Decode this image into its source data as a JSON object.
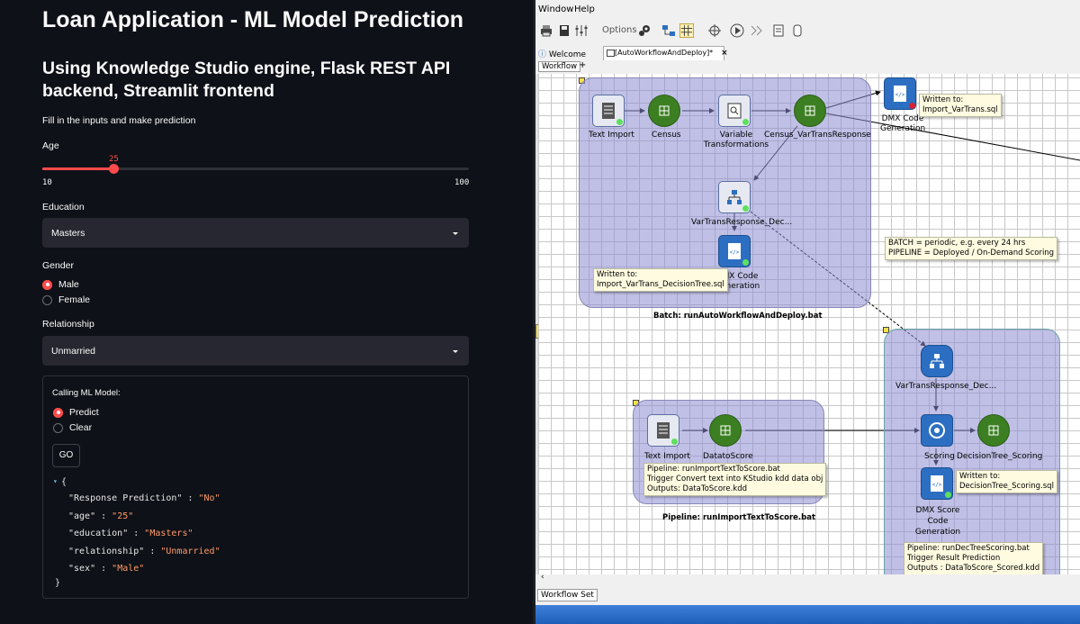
{
  "app": {
    "title": "Loan Application - ML Model Prediction",
    "subtitle": "Using Knowledge Studio engine, Flask REST API backend, Streamlit frontend",
    "instructions": "Fill in the inputs and make prediction"
  },
  "age": {
    "label": "Age",
    "value": "25",
    "value_num": 25,
    "min": "10",
    "max": "100",
    "min_num": 10,
    "max_num": 100
  },
  "education": {
    "label": "Education",
    "selected": "Masters"
  },
  "gender": {
    "label": "Gender",
    "options": [
      "Male",
      "Female"
    ],
    "selected": "Male"
  },
  "relationship": {
    "label": "Relationship",
    "selected": "Unmarried"
  },
  "form": {
    "title": "Calling ML Model:",
    "options": [
      "Predict",
      "Clear"
    ],
    "selected": "Predict",
    "button": "GO"
  },
  "response": {
    "open": "{",
    "close": "}",
    "rows": [
      {
        "key": "\"Response Prediction\"",
        "value": "\"No\""
      },
      {
        "key": "\"age\"",
        "value": "\"25\""
      },
      {
        "key": "\"education\"",
        "value": "\"Masters\""
      },
      {
        "key": "\"relationship\"",
        "value": "\"Unmarried\""
      },
      {
        "key": "\"sex\"",
        "value": "\"Male\""
      }
    ]
  },
  "studio": {
    "menu": [
      "Window",
      "Help"
    ],
    "options_label": "Options",
    "tabs": {
      "welcome": "Welcome",
      "active": "[AutoWorkflowAndDeploy]*"
    },
    "subtab": "Workflow",
    "bottom_tab": "Workflow Set",
    "batch": {
      "nodes": {
        "text_import": "Text Import",
        "census": "Census",
        "variable_transformations": "Variable Transformations",
        "census_vartrans": "Census_VarTransResponse",
        "vartrans_dec": "VarTransResponse_Dec...",
        "dmx_code_1": "DMX Code Generation",
        "dmx_code_2": "DMX Code Generation"
      },
      "note_import": [
        "Written to:",
        "Import_VarTrans.sql"
      ],
      "note_decision": [
        "Written to:",
        "Import_VarTrans_DecisionTree.sql"
      ],
      "title": "Batch: runAutoWorkflowAndDeploy.bat"
    },
    "batch_pipeline_note": [
      "BATCH = periodic, e.g. every 24 hrs",
      "PIPELINE = Deployed / On-Demand Scoring"
    ],
    "pipeline": {
      "nodes": {
        "text_import": "Text Import",
        "datatoscore": "DatatoScore"
      },
      "note": [
        "Pipeline: runImportTextToScore.bat",
        "Trigger Convert text into KStudio kdd data obj",
        "Outputs: DataToScore.kdd"
      ],
      "title": "Pipeline: runImportTextToScore.bat"
    },
    "scoring": {
      "nodes": {
        "vartrans_dec": "VarTransResponse_Dec...",
        "scoring": "Scoring",
        "decisiontree_scoring": "DecisionTree_Scoring",
        "dmx_score": "DMX Score Code Generation"
      },
      "note_written": [
        "Written to:",
        "DecisionTree_Scoring.sql"
      ],
      "note": [
        "Pipeline: runDecTreeScoring.bat",
        "Trigger Result Prediction",
        "Outputs : DataToScore_Scored.kdd"
      ]
    }
  },
  "colors": {
    "accent": "#ff4b4b",
    "dark_bg": "#0e1117",
    "widget_bg": "#262730",
    "group_fill": "#a3a3d8",
    "node_green": "#3c7f23",
    "node_blue": "#2c6fc2"
  }
}
